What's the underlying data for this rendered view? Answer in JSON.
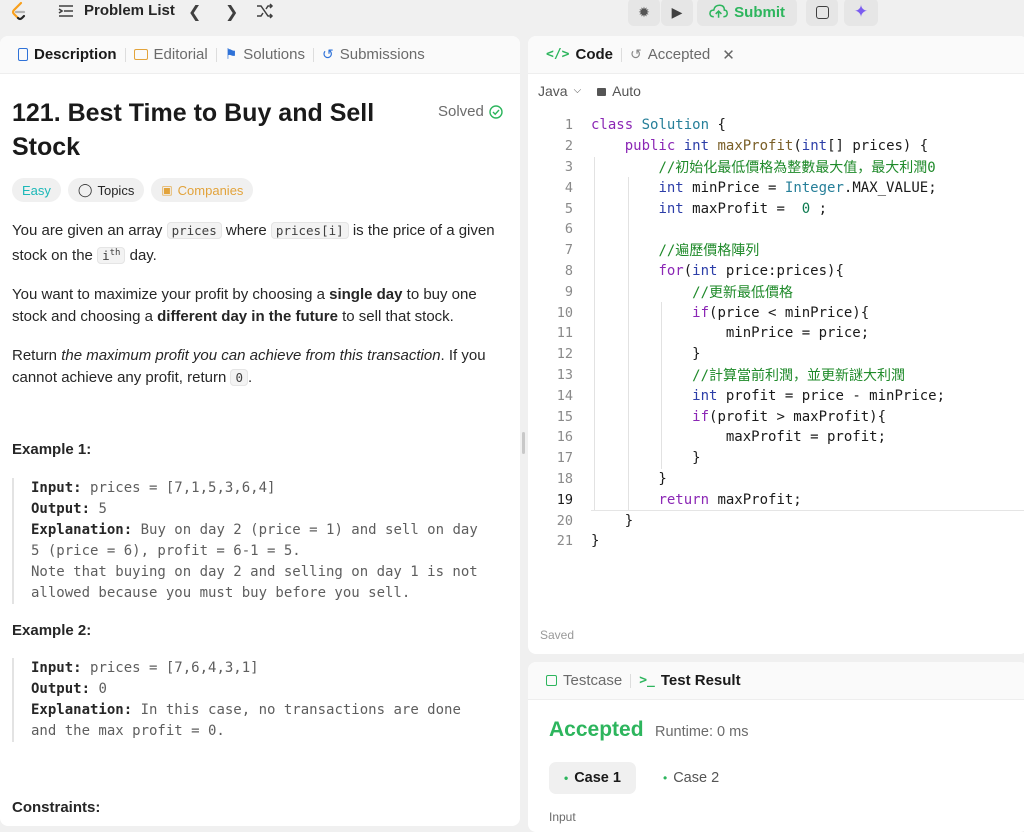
{
  "topbar": {
    "problem_list": "Problem List",
    "submit": "Submit"
  },
  "left_tabs": [
    "Description",
    "Editorial",
    "Solutions",
    "Submissions"
  ],
  "problem": {
    "title": "121. Best Time to Buy and Sell Stock",
    "status": "Solved",
    "difficulty": "Easy",
    "topics": "Topics",
    "companies": "Companies",
    "p1_a": "You are given an array",
    "p1_code1": "prices",
    "p1_b": "where",
    "p1_code2": "prices[i]",
    "p1_c": "is the price of a given stock on the",
    "p1_code3": "i",
    "p1_sup": "th",
    "p1_d": "day.",
    "p2_a": "You want to maximize your profit by choosing a",
    "p2_bold1": "single day",
    "p2_b": "to buy one stock and choosing a",
    "p2_bold2": "different day in the future",
    "p2_c": "to sell that stock.",
    "p3_a": "Return",
    "p3_italic": "the maximum profit you can achieve from this transaction",
    "p3_b": ". If you cannot achieve any profit, return",
    "p3_code": "0",
    "p3_c": ".",
    "example1_title": "Example 1:",
    "example1_input_label": "Input:",
    "example1_input": "prices = [7,1,5,3,6,4]",
    "example1_output_label": "Output:",
    "example1_output": "5",
    "example1_expl_label": "Explanation:",
    "example1_expl_1": "Buy on day 2 (price = 1) and sell on day",
    "example1_expl_2": "5 (price = 6), profit = 6-1 = 5.",
    "example1_expl_3": "Note that buying on day 2 and selling on day 1 is not",
    "example1_expl_4": "allowed because you must buy before you sell.",
    "example2_title": "Example 2:",
    "example2_input_label": "Input:",
    "example2_input": "prices = [7,6,4,3,1]",
    "example2_output_label": "Output:",
    "example2_output": "0",
    "example2_expl_label": "Explanation:",
    "example2_expl_1": "In this case, no transactions are done",
    "example2_expl_2": "and the max profit = 0.",
    "constraints_title": "Constraints:"
  },
  "code_panel": {
    "tab_code": "Code",
    "tab_accepted": "Accepted",
    "language": "Java",
    "mode": "Auto",
    "saved": "Saved",
    "current_line": 19
  },
  "code_lines": [
    "class Solution {",
    "    public int maxProfit(int[] prices) {",
    "        //初始化最低價格為整數最大值，最大利潤0",
    "        int minPrice = Integer.MAX_VALUE;",
    "        int maxProfit =  0 ;",
    "",
    "        //遍歷價格陣列",
    "        for(int price:prices){",
    "            //更新最低價格",
    "            if(price < minPrice){",
    "                minPrice = price;",
    "            }",
    "            //計算當前利潤，並更新謎大利潤",
    "            int profit = price - minPrice;",
    "            if(profit > maxProfit){",
    "                maxProfit = profit;",
    "            }",
    "        }",
    "        return maxProfit;",
    "    }",
    "}"
  ],
  "test_panel": {
    "tab_testcase": "Testcase",
    "tab_result": "Test Result",
    "verdict": "Accepted",
    "runtime": "Runtime: 0 ms",
    "case1": "Case 1",
    "case2": "Case 2",
    "input_label": "Input"
  },
  "colors": {
    "accent_green": "#2db55d",
    "easy": "#1cb8b8",
    "companies": "#e2a33b"
  }
}
